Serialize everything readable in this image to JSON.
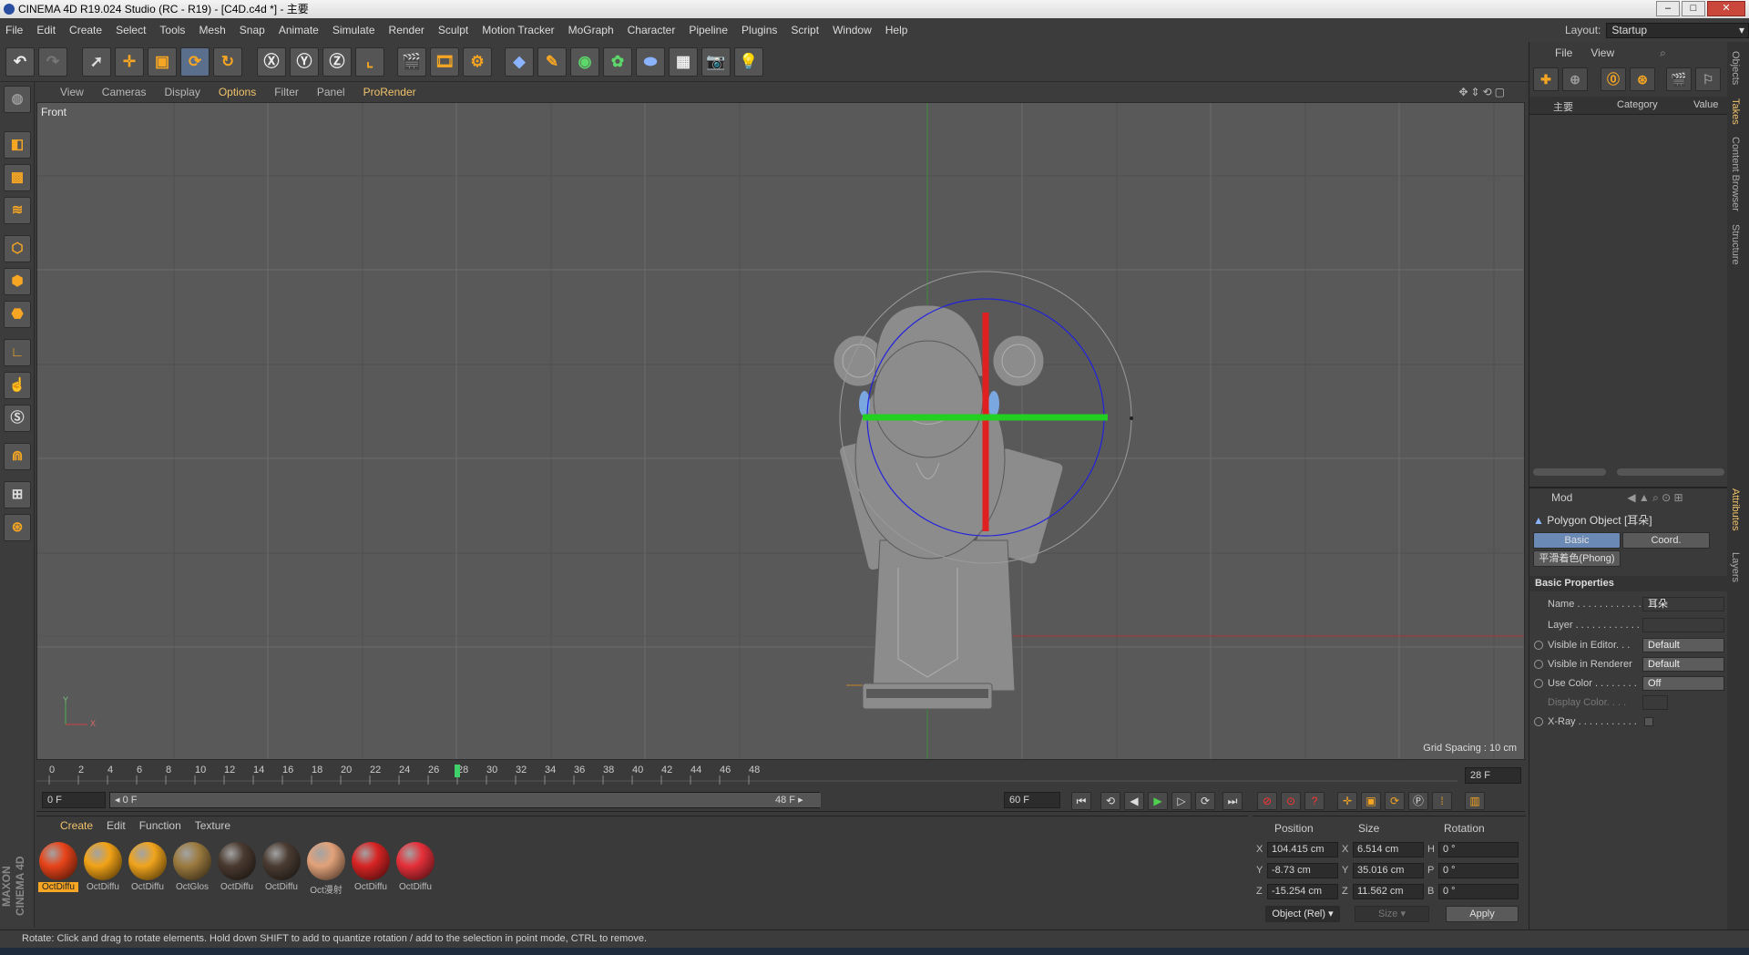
{
  "window": {
    "title": "CINEMA 4D R19.024 Studio (RC - R19) - [C4D.c4d *] - 主要",
    "minimize": "–",
    "maximize": "□",
    "close": "✕"
  },
  "menu": [
    "File",
    "Edit",
    "Create",
    "Select",
    "Tools",
    "Mesh",
    "Snap",
    "Animate",
    "Simulate",
    "Render",
    "Sculpt",
    "Motion Tracker",
    "MoGraph",
    "Character",
    "Pipeline",
    "Plugins",
    "Script",
    "Window",
    "Help"
  ],
  "layout": {
    "label": "Layout:",
    "value": "Startup"
  },
  "viewport": {
    "menu": [
      "View",
      "Cameras",
      "Display",
      "Options",
      "Filter",
      "Panel",
      "ProRender"
    ],
    "highlighted_menu": "Options",
    "label": "Front",
    "grid_spacing": "Grid Spacing : 10 cm",
    "axis_y": "Y",
    "axis_x": "X"
  },
  "timeline": {
    "ticks": [
      "0",
      "2",
      "4",
      "6",
      "8",
      "10",
      "12",
      "14",
      "16",
      "18",
      "20",
      "22",
      "24",
      "26",
      "28",
      "30",
      "32",
      "34",
      "36",
      "38",
      "40",
      "42",
      "44",
      "46",
      "48"
    ],
    "current_frame": "28 F",
    "start_field": "0 F",
    "range_start": "◂ 0 F",
    "range_end": "48 F ▸",
    "fps_field": "60 F"
  },
  "materials": {
    "menu": [
      "Create",
      "Edit",
      "Function",
      "Texture"
    ],
    "items": [
      {
        "label": "OctDiffu",
        "color": "#e8441a",
        "selected": true
      },
      {
        "label": "OctDiffu",
        "color": "#f2a317",
        "selected": false
      },
      {
        "label": "OctDiffu",
        "color": "#f0a41c",
        "selected": false
      },
      {
        "label": "OctGlos",
        "color": "#9b7a3f",
        "selected": false
      },
      {
        "label": "OctDiffu",
        "color": "#4a3a30",
        "selected": false
      },
      {
        "label": "OctDiffu",
        "color": "#4a3c32",
        "selected": false
      },
      {
        "label": "Oct漫射",
        "color": "#e2a27a",
        "selected": false
      },
      {
        "label": "OctDiffu",
        "color": "#d82424",
        "selected": false
      },
      {
        "label": "OctDiffu",
        "color": "#e6303a",
        "selected": false
      }
    ]
  },
  "coordinates": {
    "headers": {
      "position": "Position",
      "size": "Size",
      "rotation": "Rotation"
    },
    "rows": [
      {
        "axis": "X",
        "pos": "104.415 cm",
        "size_axis": "X",
        "size": "6.514 cm",
        "rot_axis": "H",
        "rot": "0 °"
      },
      {
        "axis": "Y",
        "pos": "-8.73 cm",
        "size_axis": "Y",
        "size": "35.016 cm",
        "rot_axis": "P",
        "rot": "0 °"
      },
      {
        "axis": "Z",
        "pos": "-15.254 cm",
        "size_axis": "Z",
        "size": "11.562 cm",
        "rot_axis": "B",
        "rot": "0 °"
      }
    ],
    "mode": "Object (Rel)",
    "size_mode": "Size",
    "apply": "Apply"
  },
  "object_manager": {
    "menu": [
      "File",
      "View"
    ],
    "col_name": "主要",
    "col_category": "Category",
    "col_value": "Value"
  },
  "attributes": {
    "mode": "Mod",
    "object": "Polygon Object [耳朵]",
    "tabs": [
      "Basic",
      "Coord."
    ],
    "phong": "平滑着色(Phong)",
    "section": "Basic Properties",
    "rows": [
      {
        "label": "Name . . . . . . . . . . . .",
        "value": "耳朵",
        "radio": false
      },
      {
        "label": "Layer . . . . . . . . . . . .",
        "value": "",
        "radio": false
      },
      {
        "label": "Visible in Editor. . .",
        "value": "Default",
        "radio": true
      },
      {
        "label": "Visible in Renderer",
        "value": "Default",
        "radio": true
      },
      {
        "label": "Use Color . . . . . . . .",
        "value": "Off",
        "radio": true
      },
      {
        "label": "Display Color. . . .",
        "value": "",
        "radio": false
      },
      {
        "label": "X-Ray . . . . . . . . . . .",
        "value": "",
        "radio": true
      }
    ]
  },
  "side_tabs": [
    "Objects",
    "Takes",
    "Content Browser",
    "Structure",
    "Attributes",
    "Layers"
  ],
  "status": "Rotate: Click and drag to rotate elements. Hold down SHIFT to add to quantize rotation / add to the selection in point mode, CTRL to remove.",
  "brand": "MAXON CINEMA 4D",
  "colors": {
    "accent": "#f6a623",
    "background": "#3a3a3a",
    "viewport": "#595959"
  }
}
